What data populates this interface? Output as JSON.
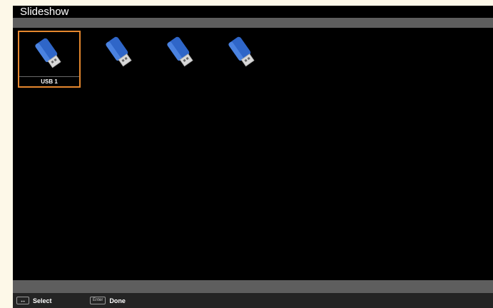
{
  "title": "Slideshow",
  "devices": [
    {
      "label": "USB 1",
      "selected": true
    },
    {
      "label": "",
      "selected": false
    },
    {
      "label": "",
      "selected": false
    },
    {
      "label": "",
      "selected": false
    }
  ],
  "footer": {
    "select_key": "↔",
    "select_label": "Select",
    "done_key": "Enter",
    "done_label": "Done"
  },
  "colors": {
    "usb_body": "#2f66c8",
    "selection": "#e5872e",
    "band": "#5e5e5e"
  }
}
